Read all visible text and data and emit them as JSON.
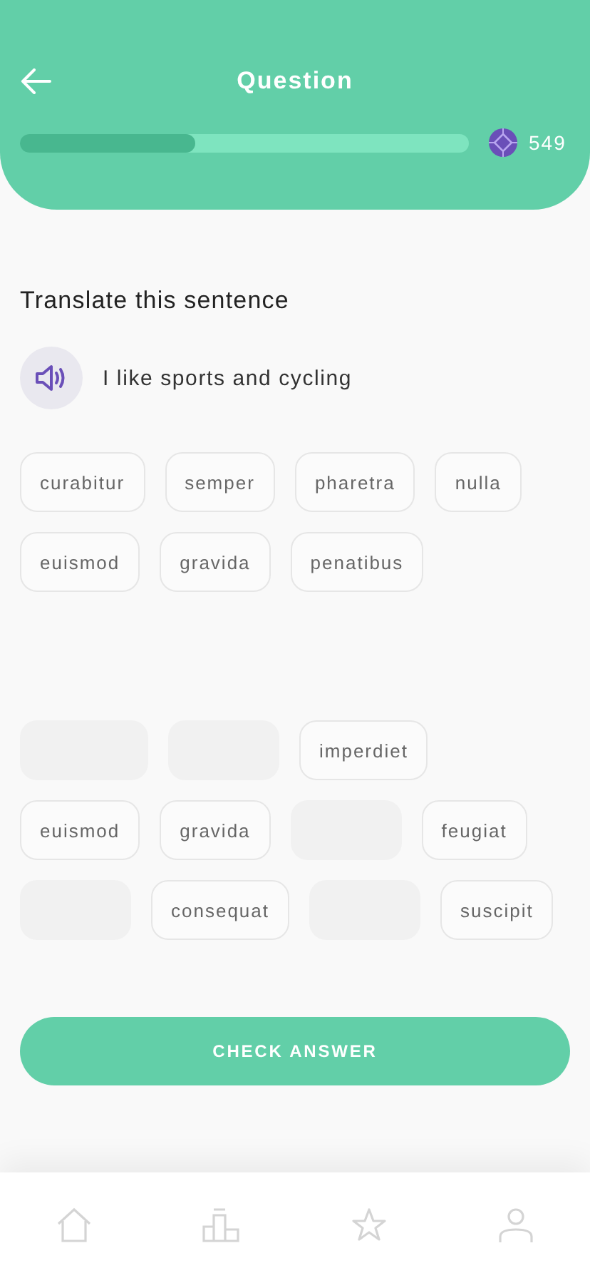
{
  "header": {
    "title": "Question",
    "progress": {
      "level": 0.39
    },
    "gems": "549"
  },
  "prompt": "Translate this sentence",
  "sentence": "I like sports and cycling",
  "word_bank": [
    [
      "curabitur",
      "semper",
      "pharetra",
      "nulla"
    ],
    [
      "euismod",
      "gravida",
      "penatibus"
    ]
  ],
  "answer_rows": [
    [
      {
        "kind": "empty"
      },
      {
        "kind": "empty"
      },
      {
        "kind": "word",
        "text": "imperdiet"
      }
    ],
    [
      {
        "kind": "word",
        "text": "euismod"
      },
      {
        "kind": "word",
        "text": "gravida"
      },
      {
        "kind": "empty"
      },
      {
        "kind": "word",
        "text": "feugiat"
      }
    ],
    [
      {
        "kind": "empty"
      },
      {
        "kind": "word",
        "text": "consequat"
      },
      {
        "kind": "empty"
      },
      {
        "kind": "word",
        "text": "suscipit"
      }
    ]
  ],
  "check_button": "CHECK ANSWER",
  "nav": [
    {
      "kind": "home"
    },
    {
      "kind": "leaderboard"
    },
    {
      "kind": "favorites"
    },
    {
      "kind": "profile"
    }
  ]
}
